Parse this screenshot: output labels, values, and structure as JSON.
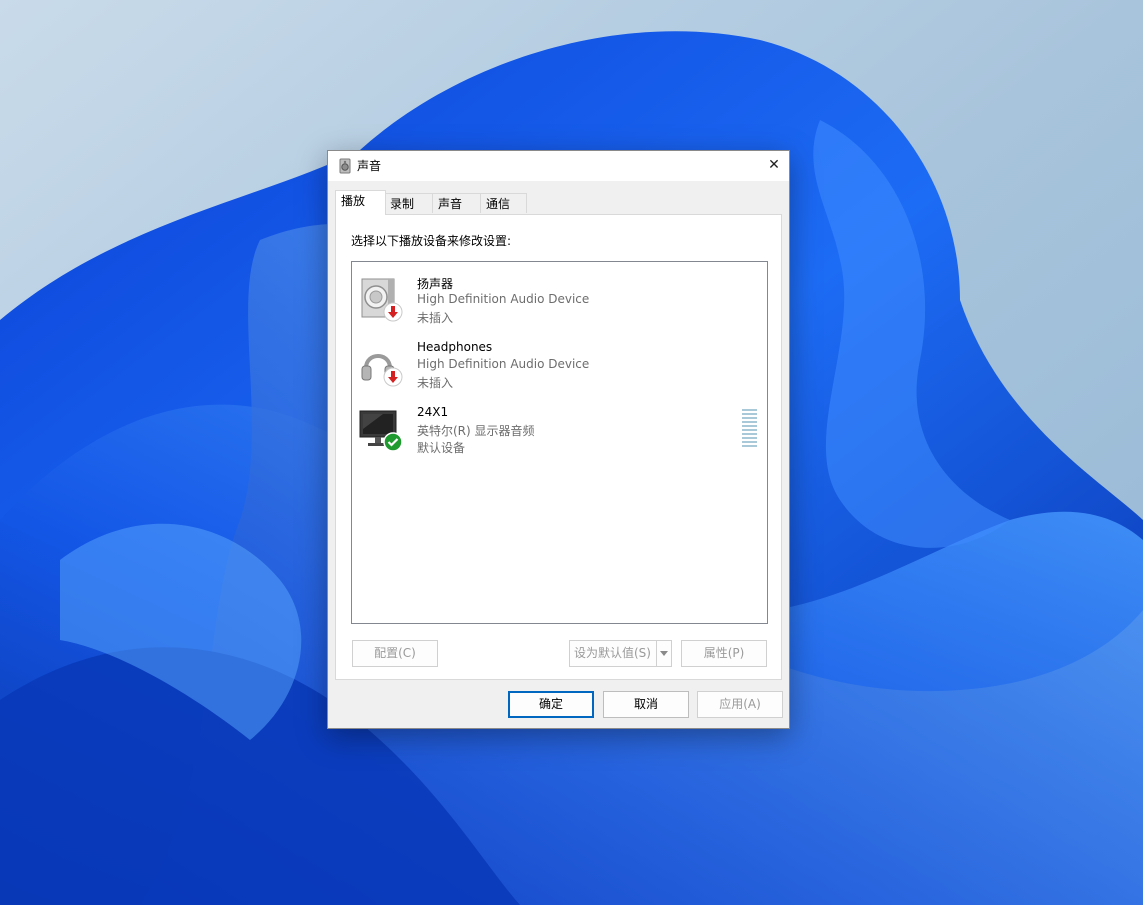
{
  "window": {
    "title": "声音",
    "close_glyph": "✕"
  },
  "tabs": [
    {
      "label": "播放",
      "active": true
    },
    {
      "label": "录制",
      "active": false
    },
    {
      "label": "声音",
      "active": false
    },
    {
      "label": "通信",
      "active": false
    }
  ],
  "panel": {
    "instruction": "选择以下播放设备来修改设置:"
  },
  "devices": [
    {
      "name": "扬声器",
      "driver": "High Definition Audio Device",
      "status": "未插入",
      "icon": "speaker-icon",
      "badge": "unplugged-badge-icon"
    },
    {
      "name": "Headphones",
      "driver": "High Definition Audio Device",
      "status": "未插入",
      "icon": "headphones-icon",
      "badge": "unplugged-badge-icon"
    },
    {
      "name": "24X1",
      "driver": "英特尔(R) 显示器音频",
      "status": "默认设备",
      "icon": "monitor-icon",
      "badge": "default-check-icon"
    }
  ],
  "buttons": {
    "configure": "配置(C)",
    "set_default": "设为默认值(S)",
    "properties": "属性(P)",
    "ok": "确定",
    "cancel": "取消",
    "apply": "应用(A)"
  },
  "colors": {
    "accent": "#0067c0",
    "unplugged_badge": "#d42020",
    "default_badge": "#1f9a2e",
    "level_meter": "#a9c9d8"
  }
}
